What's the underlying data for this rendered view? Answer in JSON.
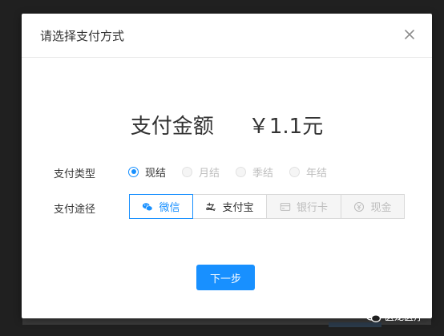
{
  "modal": {
    "title": "请选择支付方式"
  },
  "amount": {
    "label": "支付金额",
    "value": "￥1.1元"
  },
  "pay_type": {
    "label": "支付类型",
    "options": [
      {
        "label": "现结",
        "checked": true,
        "disabled": false
      },
      {
        "label": "月结",
        "checked": false,
        "disabled": true
      },
      {
        "label": "季结",
        "checked": false,
        "disabled": true
      },
      {
        "label": "年结",
        "checked": false,
        "disabled": true
      }
    ]
  },
  "pay_channel": {
    "label": "支付途径",
    "options": [
      {
        "label": "微信",
        "icon": "wechat-icon",
        "active": true,
        "disabled": false
      },
      {
        "label": "支付宝",
        "icon": "alipay-icon",
        "active": false,
        "disabled": false
      },
      {
        "label": "银行卡",
        "icon": "bank-card-icon",
        "active": false,
        "disabled": true
      },
      {
        "label": "现金",
        "icon": "cash-icon",
        "active": false,
        "disabled": true
      }
    ]
  },
  "next_button": {
    "label": "下一步"
  },
  "watermark": {
    "text": "医龙医疗"
  },
  "colors": {
    "primary": "#1890ff",
    "text": "#333333",
    "disabled_text": "#bdbdbd",
    "disabled_bg": "#f5f5f5",
    "border": "#d9d9d9",
    "backdrop": "#202020"
  }
}
